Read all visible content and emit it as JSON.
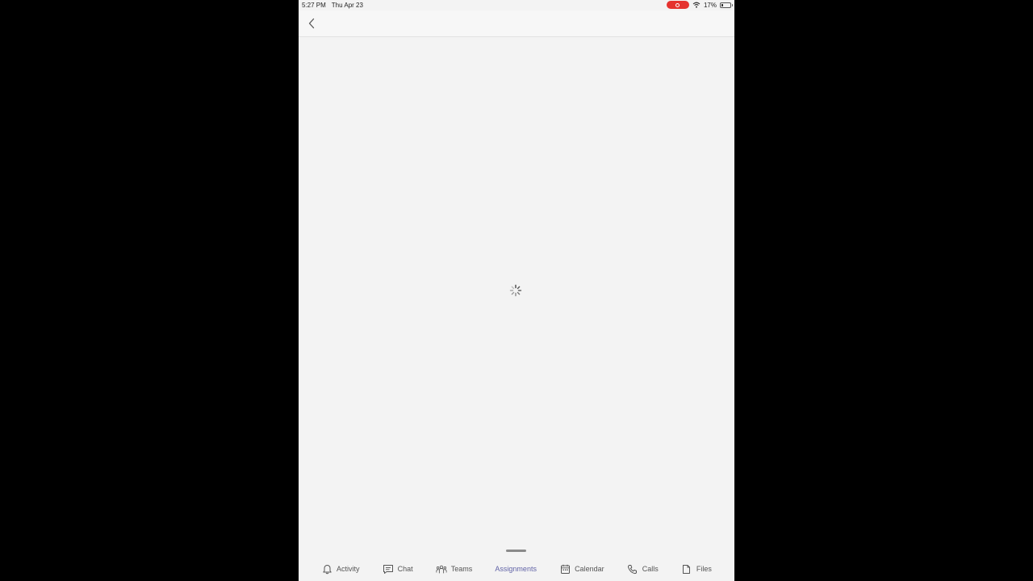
{
  "status_bar": {
    "time": "5:27 PM",
    "date": "Thu Apr 23",
    "battery_text": "17%",
    "battery_level": 0.17
  },
  "colors": {
    "accent": "#6264a7",
    "record": "#e5322e",
    "background": "#f3f3f3"
  },
  "tabs": [
    {
      "label": "Activity",
      "icon": "bell-icon"
    },
    {
      "label": "Chat",
      "icon": "chat-icon"
    },
    {
      "label": "Teams",
      "icon": "teams-icon"
    },
    {
      "label": "Assignments",
      "icon": "",
      "active": true
    },
    {
      "label": "Calendar",
      "icon": "calendar-icon"
    },
    {
      "label": "Calls",
      "icon": "phone-icon"
    },
    {
      "label": "Files",
      "icon": "file-icon"
    }
  ]
}
